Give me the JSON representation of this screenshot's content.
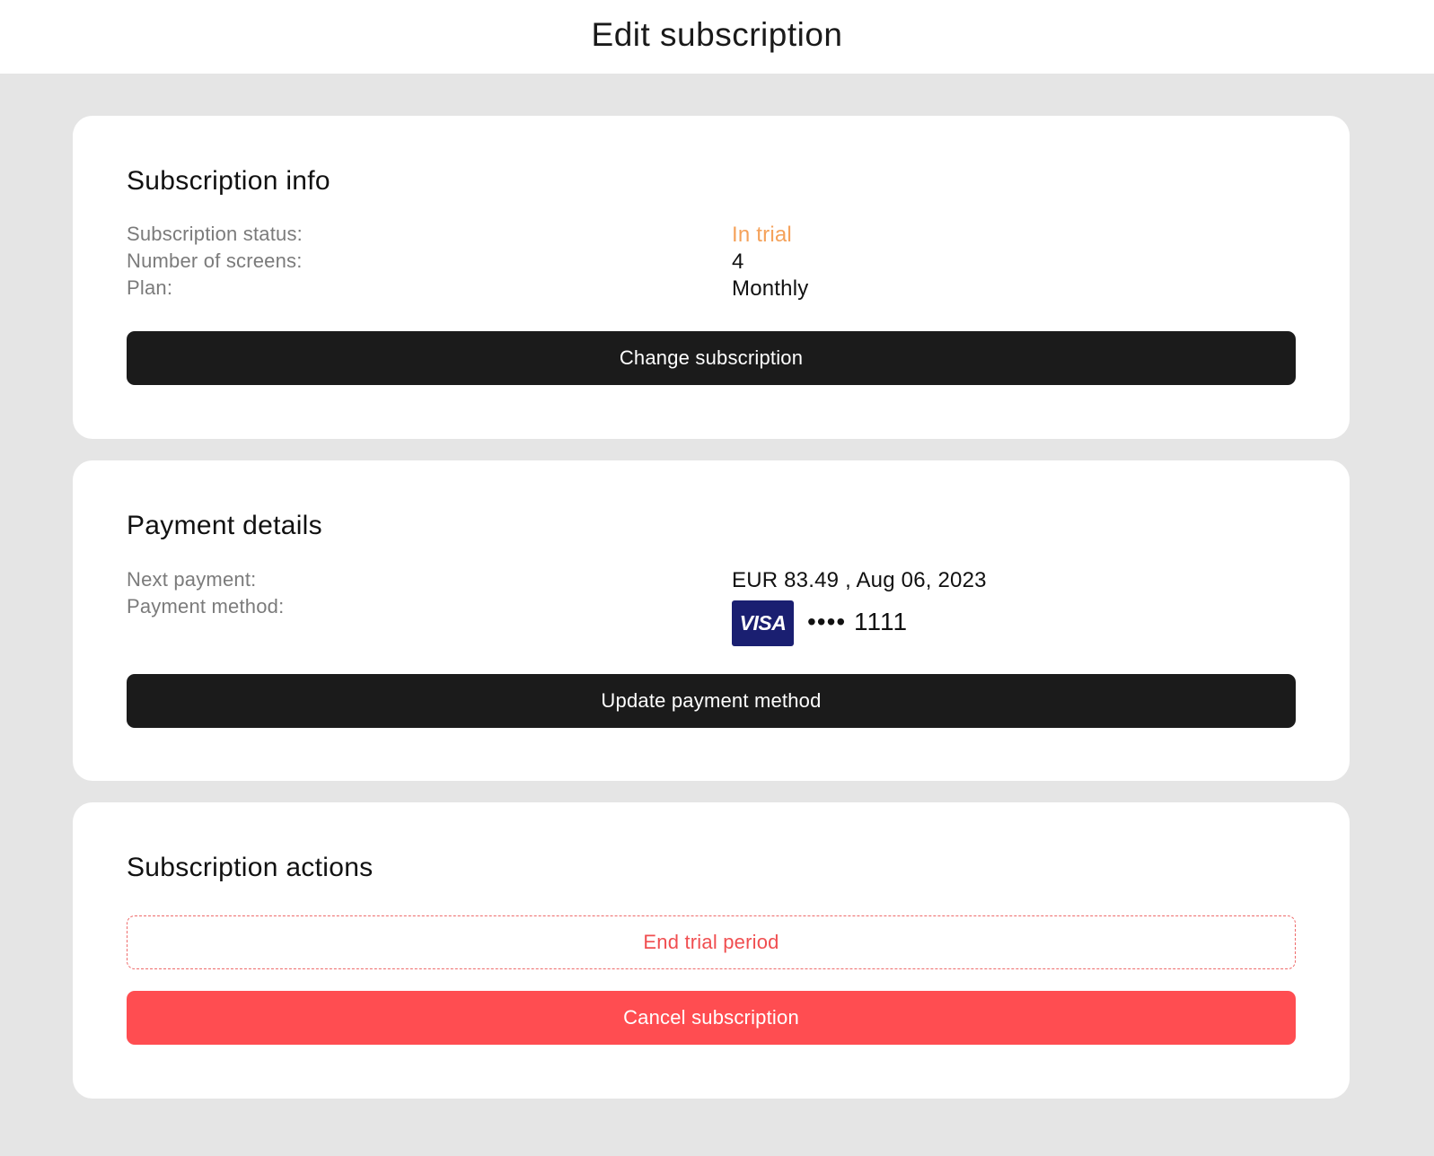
{
  "page": {
    "title": "Edit subscription"
  },
  "subscription_info": {
    "title": "Subscription info",
    "rows": [
      {
        "label": "Subscription status:",
        "value": "In trial"
      },
      {
        "label": "Number of screens:",
        "value": "4"
      },
      {
        "label": "Plan:",
        "value": "Monthly"
      }
    ],
    "button_label": "Change subscription"
  },
  "payment_details": {
    "title": "Payment details",
    "next_payment_label": "Next payment:",
    "next_payment_value": "EUR 83.49 , Aug 06, 2023",
    "payment_method_label": "Payment method:",
    "card_brand": "VISA",
    "card_number": "•••• 1111",
    "button_label": "Update payment method"
  },
  "subscription_actions": {
    "title": "Subscription actions",
    "end_trial_label": "End trial period",
    "cancel_label": "Cancel subscription"
  },
  "colors": {
    "background": "#e5e5e5",
    "card": "#ffffff",
    "dark_button": "#1b1b1b",
    "status_trial": "#f5a25b",
    "danger": "#ff4d51",
    "visa_blue": "#1a1f71"
  }
}
